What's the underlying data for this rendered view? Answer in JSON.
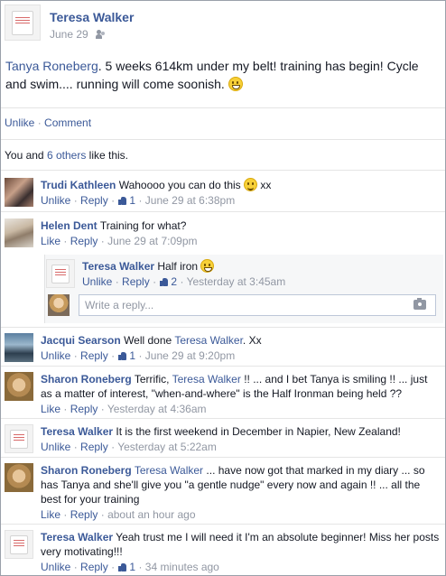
{
  "post": {
    "author": "Teresa Walker",
    "date": "June 29",
    "privacy_icon": "friends-icon",
    "tagged": "Tanya Roneberg",
    "text": ". 5 weeks 614km under my belt! training has begin! Cycle and swim.... running will come soonish.",
    "emoji": "grin-emoji",
    "unlike": "Unlike",
    "sep": "·",
    "comment": "Comment"
  },
  "likes": {
    "you": "You and ",
    "others": "6 others",
    "suffix": " like this."
  },
  "comments": [
    {
      "author": "Trudi Kathleen",
      "text": "Wahoooo you can do this",
      "after_emoji": " xx",
      "a1": "Unlike",
      "a2": "Reply",
      "likes": "1",
      "time": "June 29 at 6:38pm"
    },
    {
      "author": "Helen Dent",
      "text": "Training for what?",
      "a1": "Like",
      "a2": "Reply",
      "time": "June 29 at 7:09pm"
    },
    {
      "author": "Teresa Walker",
      "text": "Half iron",
      "a1": "Unlike",
      "a2": "Reply",
      "likes": "2",
      "time": "Yesterday at 3:45am"
    },
    {
      "author": "Jacqui Searson",
      "text": "Well done ",
      "mention": "Teresa Walker",
      "text2": ". Xx",
      "a1": "Unlike",
      "a2": "Reply",
      "likes": "1",
      "time": "June 29 at 9:20pm"
    },
    {
      "author": "Sharon Roneberg",
      "text": "Terrific, ",
      "mention": "Teresa Walker",
      "text2": " !! ... and I bet Tanya is smiling !! ... just as a matter of interest, \"when-and-where\" is the Half Ironman being held ??",
      "a1": "Like",
      "a2": "Reply",
      "time": "Yesterday at 4:36am"
    },
    {
      "author": "Teresa Walker",
      "text": "It is the first weekend in December in Napier, New Zealand!",
      "a1": "Unlike",
      "a2": "Reply",
      "time": "Yesterday at 5:22am"
    },
    {
      "author": "Sharon Roneberg",
      "mention": "Teresa Walker",
      "text2": " ... have now got that marked in my diary ... so has Tanya and she'll give you \"a gentle nudge\" every now and again !! ... all the best for your training",
      "a1": "Like",
      "a2": "Reply",
      "time": "about an hour ago"
    },
    {
      "author": "Teresa Walker",
      "text": "Yeah trust me I will need it I'm an absolute beginner! Miss her posts very motivating!!!",
      "a1": "Unlike",
      "a2": "Reply",
      "likes": "1",
      "time": "34 minutes ago"
    }
  ],
  "reply_input": {
    "placeholder": "Write a reply...",
    "camera_icon": "camera-icon"
  },
  "colors": {
    "link": "#3b5998",
    "muted": "#9197a3",
    "text": "#141823"
  }
}
